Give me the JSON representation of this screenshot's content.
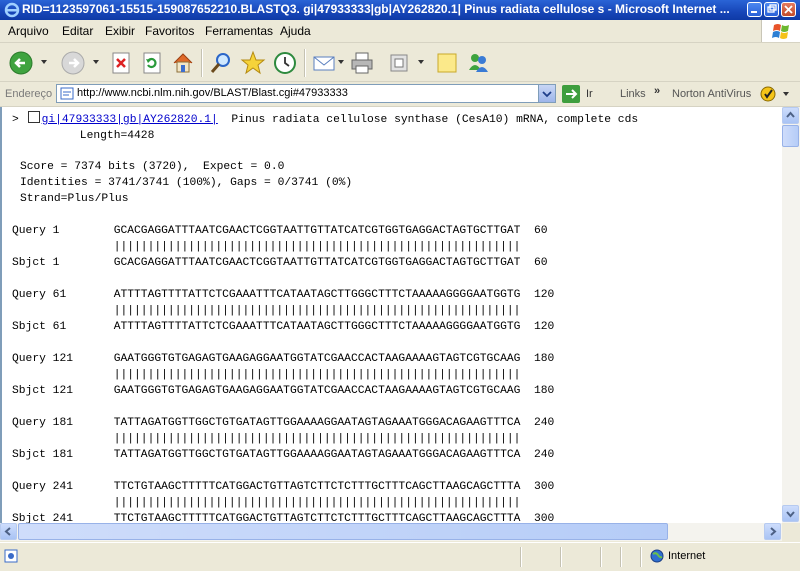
{
  "window": {
    "title": "RID=1123597061-15515-159087652210.BLASTQ3. gi|47933333|gb|AY262820.1| Pinus radiata cellulose s - Microsoft Internet ..."
  },
  "menu": {
    "items": [
      "Arquivo",
      "Editar",
      "Exibir",
      "Favoritos",
      "Ferramentas",
      "Ajuda"
    ]
  },
  "address": {
    "label": "Endereço",
    "url": "http://www.ncbi.nlm.nih.gov/BLAST/Blast.cgi#47933333",
    "go_label": "Ir",
    "links_label": "Links",
    "norton_label": "Norton AntiVirus"
  },
  "result": {
    "marker": ">",
    "accession_link": "gi|47933333|gb|AY262820.1|",
    "description": "  Pinus radiata cellulose synthase (CesA10) mRNA, complete cds",
    "length_line": "          Length=4428",
    "score_line": "Score = 7374 bits (3720),  Expect = 0.0",
    "identities_line": "Identities = 3741/3741 (100%), Gaps = 0/3741 (0%)",
    "strand_line": "Strand=Plus/Plus"
  },
  "alignment": [
    {
      "q_label": "Query",
      "q_start": "1",
      "q_seq": "GCACGAGGATTTAATCGAACTCGGTAATTGTTATCATCGTGGTGAGGACTAGTGCTTGAT",
      "q_end": "60",
      "match": "||||||||||||||||||||||||||||||||||||||||||||||||||||||||||||",
      "s_label": "Sbjct",
      "s_start": "1",
      "s_seq": "GCACGAGGATTTAATCGAACTCGGTAATTGTTATCATCGTGGTGAGGACTAGTGCTTGAT",
      "s_end": "60"
    },
    {
      "q_label": "Query",
      "q_start": "61",
      "q_seq": "ATTTTAGTTTTATTCTCGAAATTTCATAATAGCTTGGGCTTTCTAAAAAGGGGAATGGTG",
      "q_end": "120",
      "match": "||||||||||||||||||||||||||||||||||||||||||||||||||||||||||||",
      "s_label": "Sbjct",
      "s_start": "61",
      "s_seq": "ATTTTAGTTTTATTCTCGAAATTTCATAATAGCTTGGGCTTTCTAAAAAGGGGAATGGTG",
      "s_end": "120"
    },
    {
      "q_label": "Query",
      "q_start": "121",
      "q_seq": "GAATGGGTGTGAGAGTGAAGAGGAATGGTATCGAACCACTAAGAAAAGTAGTCGTGCAAG",
      "q_end": "180",
      "match": "||||||||||||||||||||||||||||||||||||||||||||||||||||||||||||",
      "s_label": "Sbjct",
      "s_start": "121",
      "s_seq": "GAATGGGTGTGAGAGTGAAGAGGAATGGTATCGAACCACTAAGAAAAGTAGTCGTGCAAG",
      "s_end": "180"
    },
    {
      "q_label": "Query",
      "q_start": "181",
      "q_seq": "TATTAGATGGTTGGCTGTGATAGTTGGAAAAGGAATAGTAGAAATGGGACAGAAGTTTCA",
      "q_end": "240",
      "match": "||||||||||||||||||||||||||||||||||||||||||||||||||||||||||||",
      "s_label": "Sbjct",
      "s_start": "181",
      "s_seq": "TATTAGATGGTTGGCTGTGATAGTTGGAAAAGGAATAGTAGAAATGGGACAGAAGTTTCA",
      "s_end": "240"
    },
    {
      "q_label": "Query",
      "q_start": "241",
      "q_seq": "TTCTGTAAGCTTTTTCATGGACTGTTAGTCTTCTCTTTGCTTTCAGCTTAAGCAGCTTTA",
      "q_end": "300",
      "match": "||||||||||||||||||||||||||||||||||||||||||||||||||||||||||||",
      "s_label": "Sbjct",
      "s_start": "241",
      "s_seq": "TTCTGTAAGCTTTTTCATGGACTGTTAGTCTTCTCTTTGCTTTCAGCTTAAGCAGCTTTA",
      "s_end": "300"
    }
  ],
  "status": {
    "zone_label": "Internet"
  },
  "toolbar": {
    "buttons": [
      "back-icon",
      "forward-icon",
      "stop-icon",
      "refresh-icon",
      "home-icon",
      "search-icon",
      "favorites-icon",
      "history-icon",
      "mail-icon",
      "print-icon",
      "edit-icon",
      "notes-icon",
      "messenger-icon"
    ]
  }
}
